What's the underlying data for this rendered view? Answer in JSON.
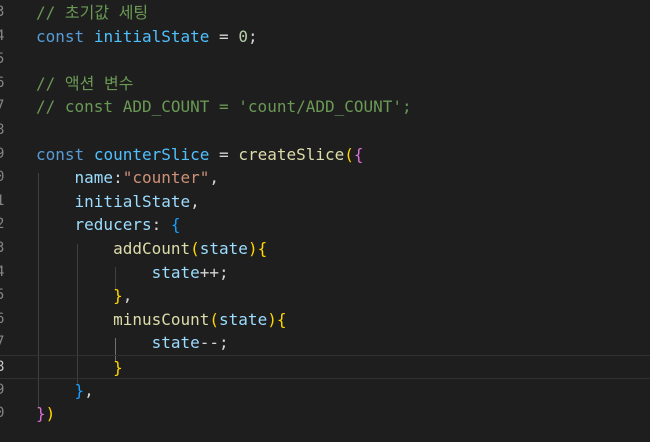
{
  "editor": {
    "lines": [
      {
        "num": "3",
        "tokens": [
          {
            "t": "// 초기값 세팅",
            "c": "comment"
          }
        ]
      },
      {
        "num": "4",
        "tokens": [
          {
            "t": "const",
            "c": "keyword"
          },
          {
            "t": " ",
            "c": "plain"
          },
          {
            "t": "initialState",
            "c": "const"
          },
          {
            "t": " = ",
            "c": "plain"
          },
          {
            "t": "0",
            "c": "number"
          },
          {
            "t": ";",
            "c": "plain"
          }
        ]
      },
      {
        "num": "5",
        "tokens": []
      },
      {
        "num": "6",
        "tokens": [
          {
            "t": "// 액션 변수",
            "c": "comment"
          }
        ]
      },
      {
        "num": "7",
        "tokens": [
          {
            "t": "// const ADD_COUNT = 'count/ADD_COUNT';",
            "c": "comment"
          }
        ]
      },
      {
        "num": "8",
        "tokens": []
      },
      {
        "num": "9",
        "tokens": [
          {
            "t": "const",
            "c": "keyword"
          },
          {
            "t": " ",
            "c": "plain"
          },
          {
            "t": "counterSlice",
            "c": "const"
          },
          {
            "t": " = ",
            "c": "plain"
          },
          {
            "t": "createSlice",
            "c": "func"
          },
          {
            "t": "(",
            "c": "b1"
          },
          {
            "t": "{",
            "c": "b2"
          }
        ]
      },
      {
        "num": "0",
        "tokens": [
          {
            "t": "    ",
            "c": "plain"
          },
          {
            "t": "name",
            "c": "var"
          },
          {
            "t": ":",
            "c": "plain"
          },
          {
            "t": "\"counter\"",
            "c": "string"
          },
          {
            "t": ",",
            "c": "plain"
          }
        ]
      },
      {
        "num": "1",
        "tokens": [
          {
            "t": "    ",
            "c": "plain"
          },
          {
            "t": "initialState",
            "c": "var"
          },
          {
            "t": ",",
            "c": "plain"
          }
        ]
      },
      {
        "num": "2",
        "tokens": [
          {
            "t": "    ",
            "c": "plain"
          },
          {
            "t": "reducers",
            "c": "var"
          },
          {
            "t": ": ",
            "c": "plain"
          },
          {
            "t": "{",
            "c": "b3"
          }
        ]
      },
      {
        "num": "3",
        "tokens": [
          {
            "t": "        ",
            "c": "plain"
          },
          {
            "t": "addCount",
            "c": "func"
          },
          {
            "t": "(",
            "c": "b1"
          },
          {
            "t": "state",
            "c": "var"
          },
          {
            "t": ")",
            "c": "b1"
          },
          {
            "t": "{",
            "c": "b1"
          }
        ]
      },
      {
        "num": "4",
        "tokens": [
          {
            "t": "            ",
            "c": "plain"
          },
          {
            "t": "state",
            "c": "var"
          },
          {
            "t": "++;",
            "c": "plain"
          }
        ]
      },
      {
        "num": "5",
        "tokens": [
          {
            "t": "        ",
            "c": "plain"
          },
          {
            "t": "}",
            "c": "b1"
          },
          {
            "t": ",",
            "c": "plain"
          }
        ]
      },
      {
        "num": "6",
        "tokens": [
          {
            "t": "        ",
            "c": "plain"
          },
          {
            "t": "minusCount",
            "c": "func"
          },
          {
            "t": "(",
            "c": "b1"
          },
          {
            "t": "state",
            "c": "var"
          },
          {
            "t": ")",
            "c": "b1"
          },
          {
            "t": "{",
            "c": "b1"
          }
        ]
      },
      {
        "num": "7",
        "tokens": [
          {
            "t": "            ",
            "c": "plain"
          },
          {
            "t": "state",
            "c": "var"
          },
          {
            "t": "--;",
            "c": "plain"
          }
        ]
      },
      {
        "num": "8",
        "tokens": [
          {
            "t": "        ",
            "c": "plain"
          },
          {
            "t": "}",
            "c": "b1"
          }
        ]
      },
      {
        "num": "9",
        "tokens": [
          {
            "t": "    ",
            "c": "plain"
          },
          {
            "t": "}",
            "c": "b3"
          },
          {
            "t": ",",
            "c": "plain"
          }
        ]
      },
      {
        "num": "0",
        "tokens": [
          {
            "t": "}",
            "c": "b2"
          },
          {
            "t": ")",
            "c": "b1"
          }
        ]
      }
    ],
    "current_line_index": 15,
    "colors": {
      "background": "#1e1e1e",
      "comment": "#6a9955",
      "keyword": "#569cd6",
      "constant": "#4fc1ff",
      "variable": "#9cdcfe",
      "function": "#dcdcaa",
      "string": "#ce9178",
      "number": "#b5cea8",
      "bracket_gold": "#ffd700",
      "bracket_orchid": "#da70d6",
      "bracket_blue": "#179fff"
    }
  }
}
